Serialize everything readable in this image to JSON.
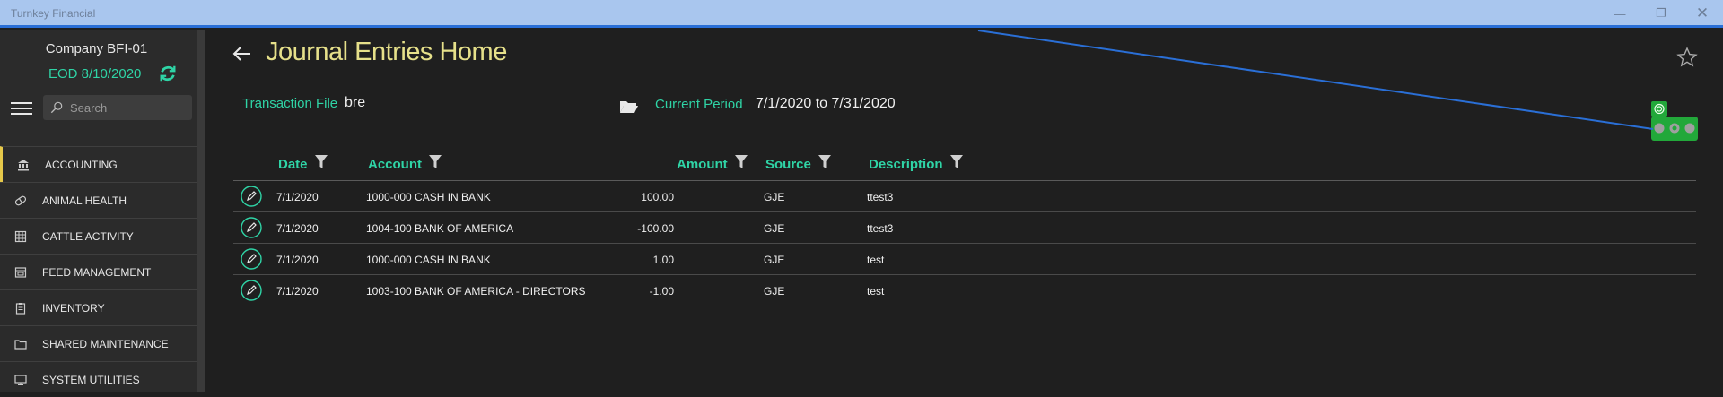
{
  "window": {
    "title": "Turnkey Financial",
    "minimize_glyph": "—",
    "maximize_glyph": "❐",
    "close_glyph": "✕"
  },
  "sidebar": {
    "company": "Company BFI-01",
    "eod": "EOD 8/10/2020",
    "search_placeholder": "Search",
    "items": [
      {
        "label": "ACCOUNTING",
        "icon": "bank-icon",
        "active": true
      },
      {
        "label": "ANIMAL HEALTH",
        "icon": "pill-icon"
      },
      {
        "label": "CATTLE ACTIVITY",
        "icon": "building-icon"
      },
      {
        "label": "FEED MANAGEMENT",
        "icon": "feed-icon"
      },
      {
        "label": "INVENTORY",
        "icon": "clipboard-icon"
      },
      {
        "label": "SHARED MAINTENANCE",
        "icon": "folder-icon"
      },
      {
        "label": "SYSTEM UTILITIES",
        "icon": "monitor-icon"
      }
    ]
  },
  "main": {
    "title": "Journal Entries Home",
    "transaction_file_label": "Transaction File",
    "transaction_file_value": "bre",
    "current_period_label": "Current Period",
    "current_period_value": "7/1/2020 to 7/31/2020"
  },
  "grid": {
    "columns": [
      "Date",
      "Account",
      "Amount",
      "Source",
      "Description"
    ],
    "rows": [
      {
        "date": "7/1/2020",
        "account": "1000-000 CASH IN BANK",
        "amount": "100.00",
        "source": "GJE",
        "description": "ttest3"
      },
      {
        "date": "7/1/2020",
        "account": "1004-100 BANK OF AMERICA",
        "amount": "-100.00",
        "source": "GJE",
        "description": "ttest3"
      },
      {
        "date": "7/1/2020",
        "account": "1000-000 CASH IN BANK",
        "amount": "1.00",
        "source": "GJE",
        "description": "test"
      },
      {
        "date": "7/1/2020",
        "account": "1003-100 BANK OF AMERICA - DIRECTORS",
        "amount": "-1.00",
        "source": "GJE",
        "description": "test"
      }
    ]
  },
  "colors": {
    "accent": "#2fd4a6",
    "title": "#e6e08a",
    "titlebar": "#a9c6ee",
    "active_nav": "#e6c84a",
    "overlay_line": "#2a6fd6",
    "widget": "#22a83a"
  }
}
